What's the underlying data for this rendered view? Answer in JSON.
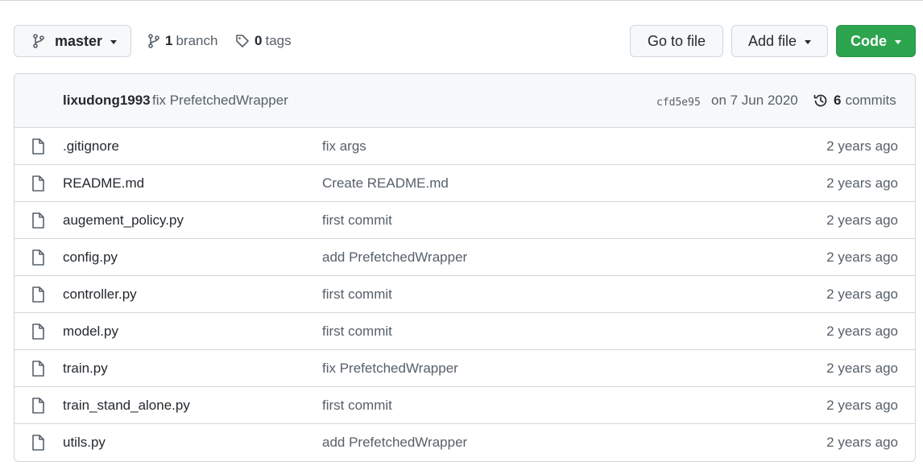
{
  "toolbar": {
    "branch_button": {
      "label": "master",
      "icon": "git-branch-icon"
    },
    "branches": {
      "count": "1",
      "label": "branch",
      "icon": "git-branch-icon"
    },
    "tags": {
      "count": "0",
      "label": "tags",
      "icon": "tag-icon"
    },
    "goto_file_label": "Go to file",
    "add_file_label": "Add file",
    "code_label": "Code",
    "code_color": "#2da44e"
  },
  "latest_commit": {
    "author": "lixudong1993",
    "message": "fix PrefetchedWrapper",
    "sha": "cfd5e95",
    "date": "on 7 Jun 2020",
    "commits_count": "6",
    "commits_label": "commits",
    "history_icon": "history-icon"
  },
  "files": [
    {
      "name": ".gitignore",
      "message": "fix args",
      "age": "2 years ago",
      "icon": "file-icon"
    },
    {
      "name": "README.md",
      "message": "Create README.md",
      "age": "2 years ago",
      "icon": "file-icon"
    },
    {
      "name": "augement_policy.py",
      "message": "first commit",
      "age": "2 years ago",
      "icon": "file-icon"
    },
    {
      "name": "config.py",
      "message": "add PrefetchedWrapper",
      "age": "2 years ago",
      "icon": "file-icon"
    },
    {
      "name": "controller.py",
      "message": "first commit",
      "age": "2 years ago",
      "icon": "file-icon"
    },
    {
      "name": "model.py",
      "message": "first commit",
      "age": "2 years ago",
      "icon": "file-icon"
    },
    {
      "name": "train.py",
      "message": "fix PrefetchedWrapper",
      "age": "2 years ago",
      "icon": "file-icon"
    },
    {
      "name": "train_stand_alone.py",
      "message": "first commit",
      "age": "2 years ago",
      "icon": "file-icon"
    },
    {
      "name": "utils.py",
      "message": "add PrefetchedWrapper",
      "age": "2 years ago",
      "icon": "file-icon"
    }
  ]
}
